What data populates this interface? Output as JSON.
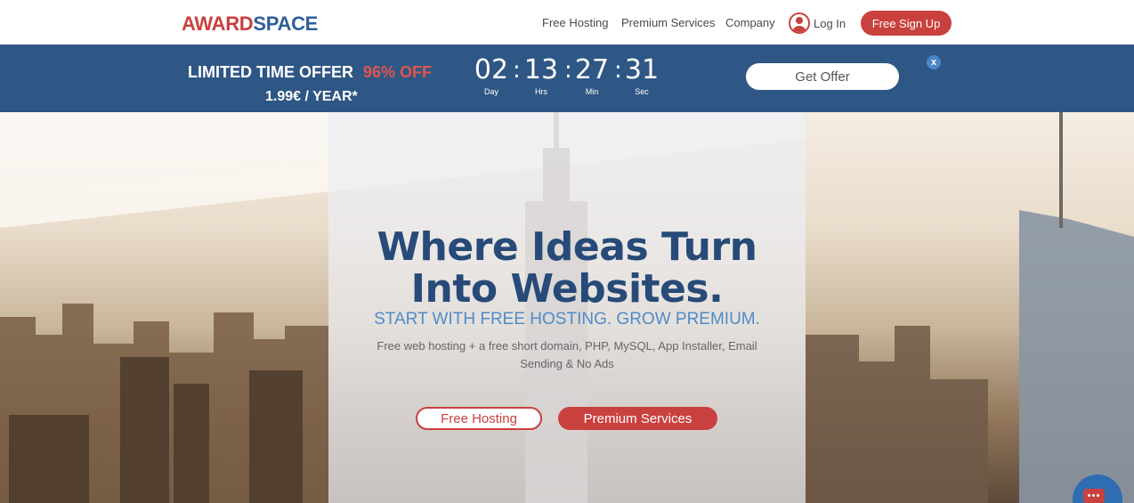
{
  "header": {
    "logo": {
      "part1": "AWARD",
      "part2": "SPACE"
    },
    "nav": {
      "free_hosting": "Free Hosting",
      "premium_services": "Premium Services",
      "company": "Company"
    },
    "login_label": "Log In",
    "signup_label": "Free Sign Up"
  },
  "offer": {
    "title": "LIMITED TIME OFFER",
    "discount": "96% OFF",
    "price": "1.99€ / YEAR*",
    "countdown": {
      "days": "02",
      "hours": "13",
      "minutes": "27",
      "seconds": "31",
      "days_label": "Day",
      "hours_label": "Hrs",
      "minutes_label": "Min",
      "seconds_label": "Sec",
      "separator": ":"
    },
    "cta_label": "Get Offer",
    "close_label": "x"
  },
  "hero": {
    "headline": "Where Ideas Turn Into Websites.",
    "subhead": "START WITH FREE HOSTING. GROW PREMIUM.",
    "description": "Free web hosting + a free short domain, PHP, MySQL, App Installer, Email Sending & No Ads",
    "free_button": "Free Hosting",
    "premium_button": "Premium Services"
  },
  "colors": {
    "brand_red": "#c9413e",
    "brand_blue": "#2f5f9a",
    "offer_bar": "#2f5785",
    "headline_blue": "#274a78",
    "subhead_blue": "#4f8cc7"
  },
  "icons": {
    "user": "user-icon",
    "close": "close-icon",
    "chat": "chat-icon"
  }
}
